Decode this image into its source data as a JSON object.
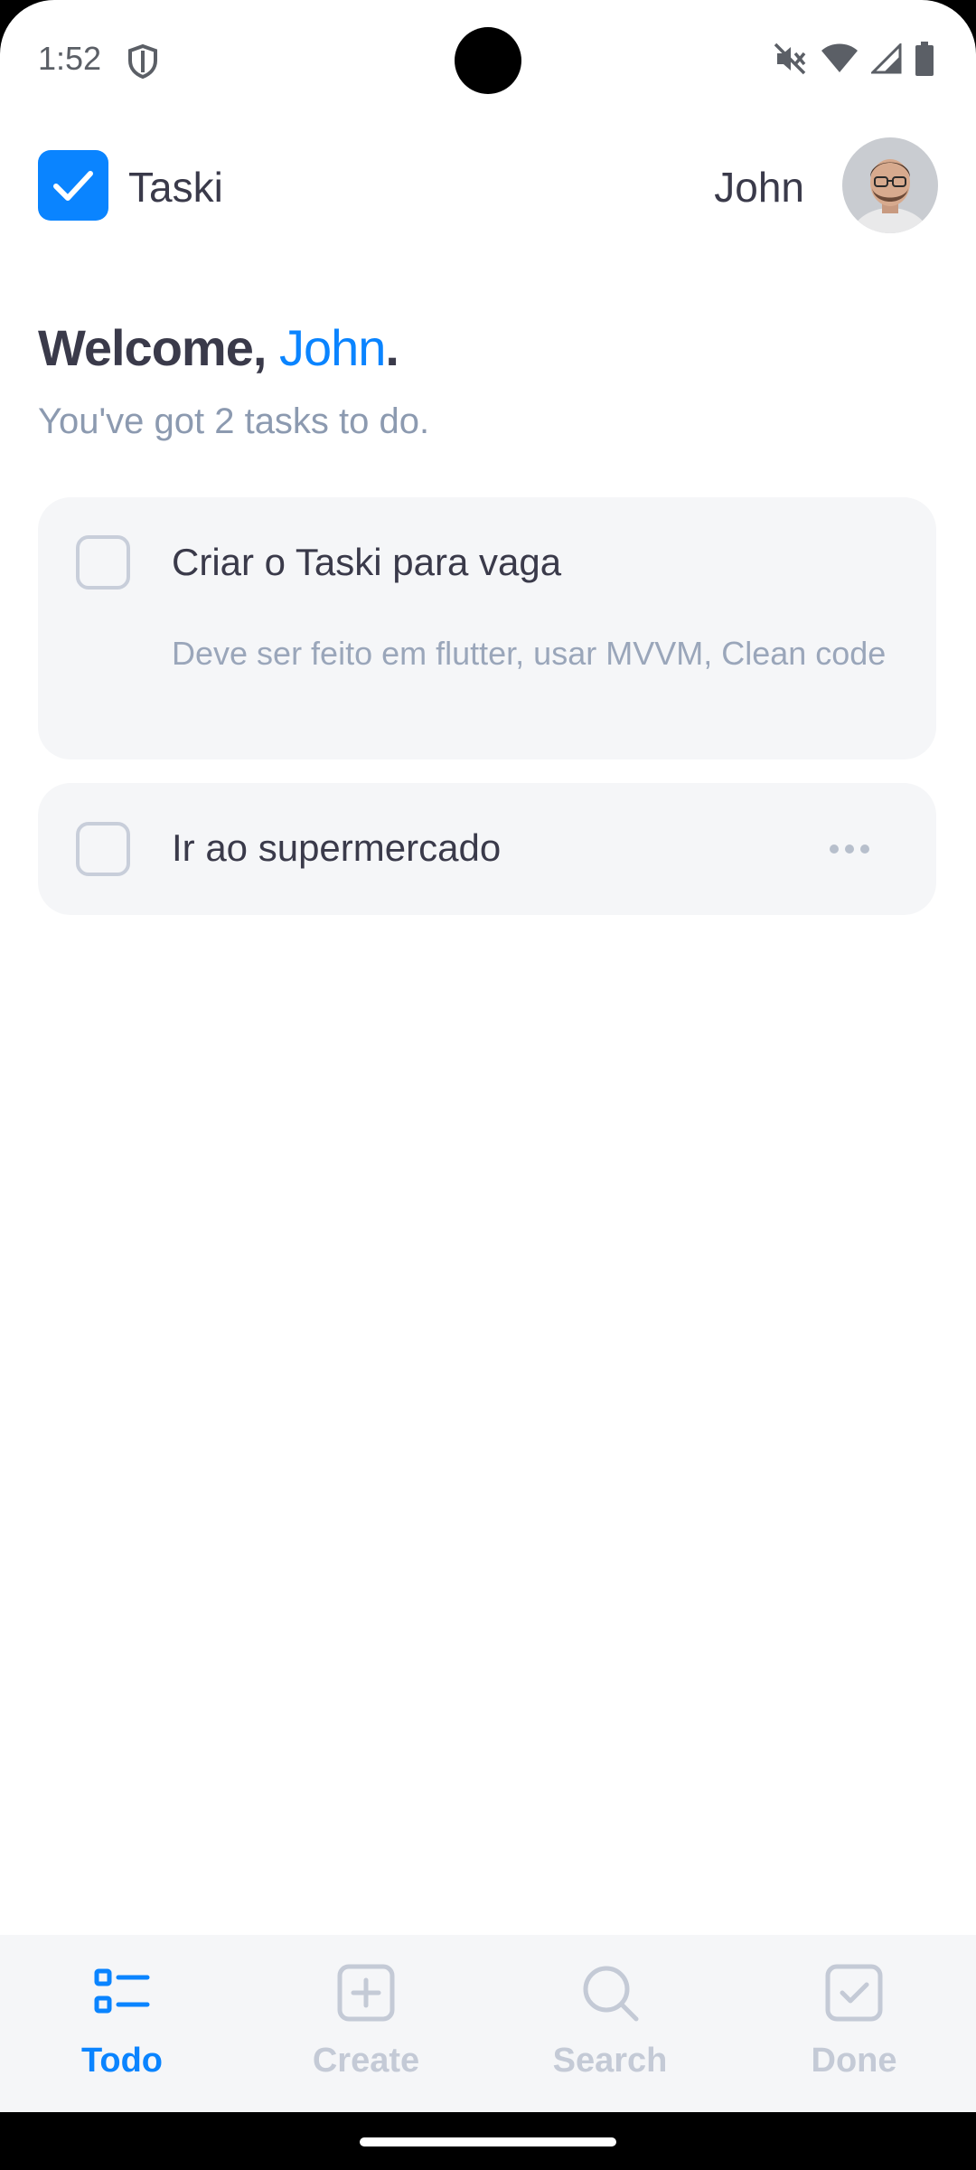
{
  "status_bar": {
    "time": "1:52",
    "icons": [
      "shield-icon",
      "mute-icon",
      "wifi-icon",
      "signal-icon",
      "battery-icon"
    ]
  },
  "app_bar": {
    "app_name": "Taski",
    "user_name": "John"
  },
  "welcome": {
    "greeting": "Welcome, ",
    "name": "John",
    "punct": ".",
    "subtitle": "You've got 2 tasks to do."
  },
  "tasks": [
    {
      "title": "Criar o Taski para vaga",
      "description": "Deve ser feito em flutter, usar MVVM, Clean code",
      "done": false
    },
    {
      "title": "Ir ao supermercado",
      "description": "",
      "done": false
    }
  ],
  "bottom_nav": {
    "items": [
      {
        "label": "Todo",
        "icon": "todo-list-icon",
        "active": true
      },
      {
        "label": "Create",
        "icon": "plus-square-icon",
        "active": false
      },
      {
        "label": "Search",
        "icon": "search-icon",
        "active": false
      },
      {
        "label": "Done",
        "icon": "check-square-icon",
        "active": false
      }
    ]
  },
  "colors": {
    "accent": "#0a84ff",
    "text_primary": "#3a3a4a",
    "text_secondary": "#8c9ab0",
    "card_bg": "#f5f6f8",
    "nav_inactive": "#c4cad6"
  }
}
